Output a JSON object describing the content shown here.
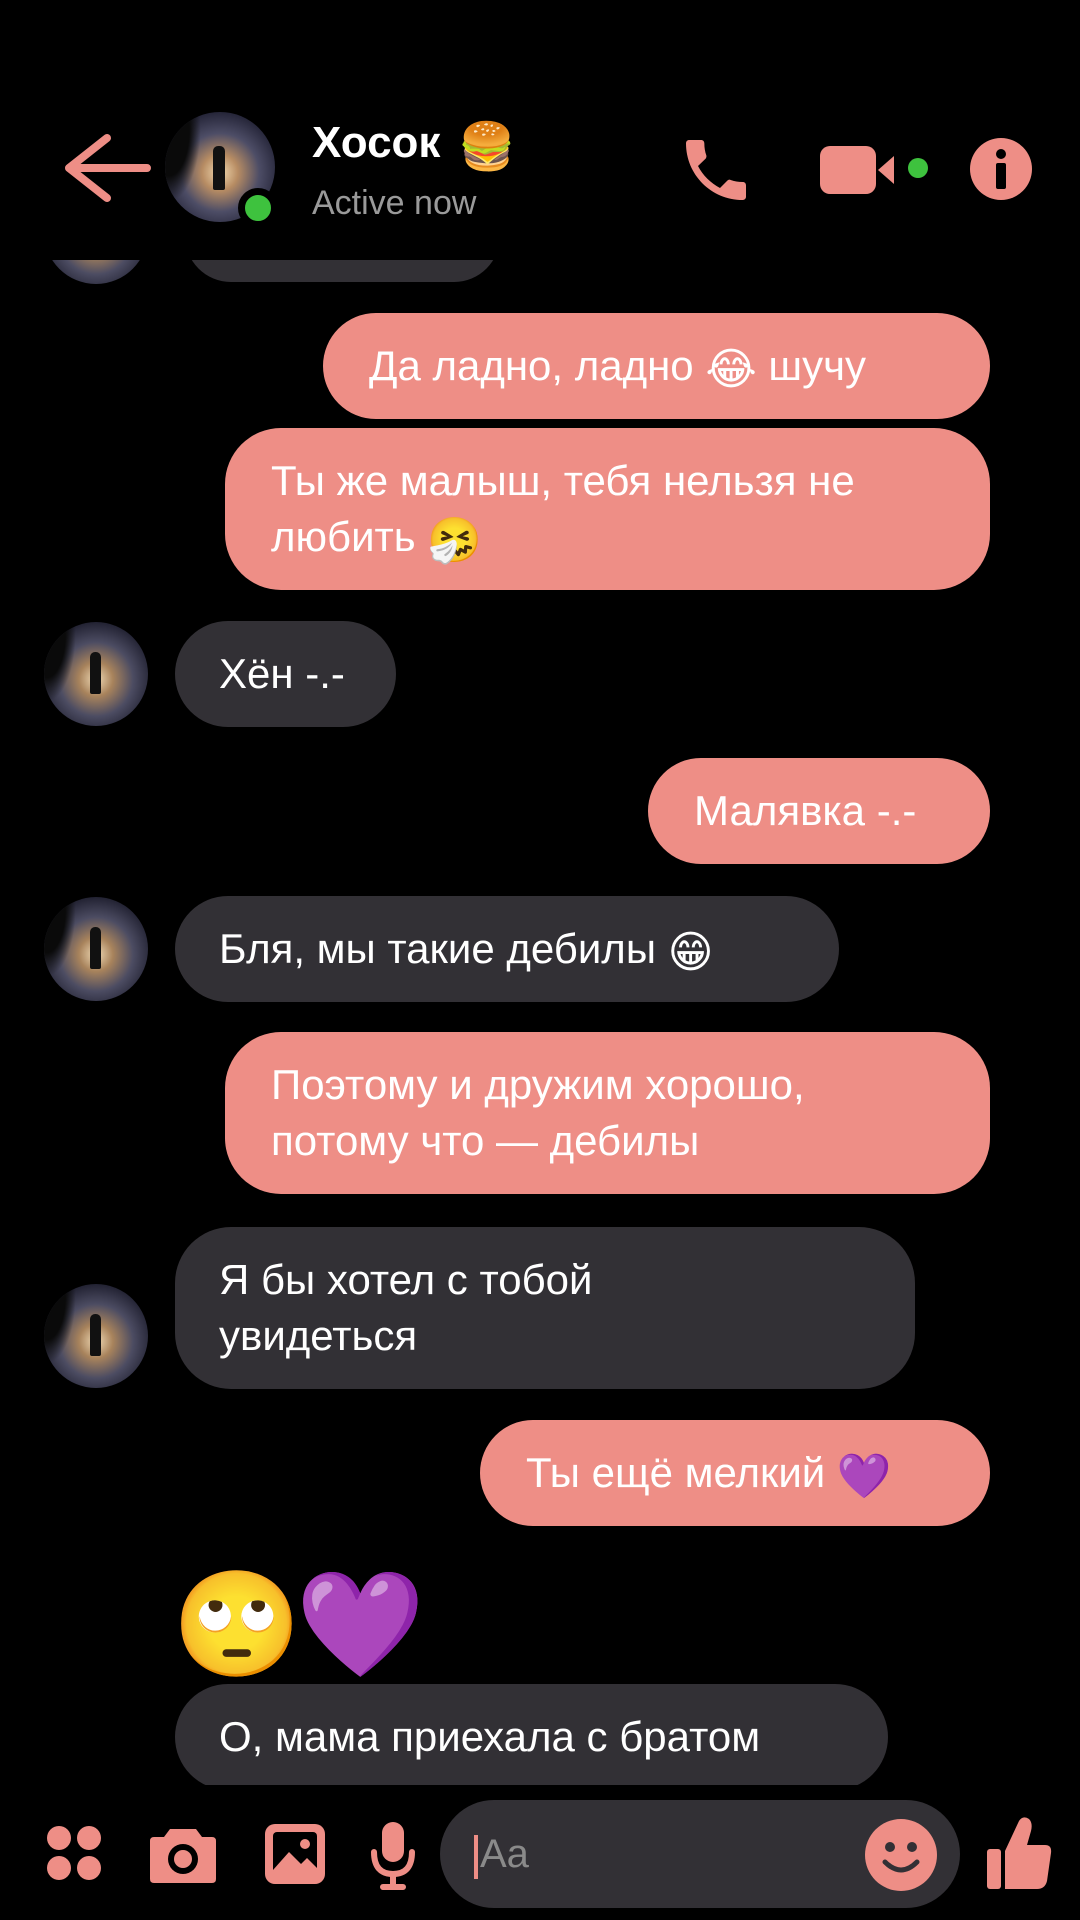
{
  "header": {
    "back_icon": "arrow-left-icon",
    "contact_name": "Хосок",
    "name_emoji": "🍔",
    "status": "Active now",
    "call_icon": "phone-icon",
    "video_icon": "video-camera-icon",
    "info_icon": "info-icon"
  },
  "messages": [
    {
      "dir": "sent",
      "text": "Да ладно, ладно ",
      "emoji": "😂",
      "tail": " шучу"
    },
    {
      "dir": "sent",
      "line1": "Ты же малыш, тебя нельзя не",
      "line2": "любить ",
      "emoji": "🤧"
    },
    {
      "dir": "received",
      "text": "Хён -.-"
    },
    {
      "dir": "sent",
      "text": "Малявка -.-"
    },
    {
      "dir": "received",
      "text": "Бля, мы такие дебилы ",
      "emoji": "😁"
    },
    {
      "dir": "sent",
      "line1": "Поэтому и дружим хорошо,",
      "line2": "потому что — дебилы"
    },
    {
      "dir": "received",
      "line1": "Я бы хотел с тобой",
      "line2": "увидеться"
    },
    {
      "dir": "sent",
      "text": "Ты ещё мелкий ",
      "emoji": "💜"
    },
    {
      "dir": "received",
      "emojis": "🙄💜"
    },
    {
      "dir": "received",
      "text": "О, мама приехала с братом"
    }
  ],
  "composer": {
    "apps_icon": "apps-dots-icon",
    "camera_icon": "camera-icon",
    "gallery_icon": "image-gallery-icon",
    "mic_icon": "microphone-icon",
    "placeholder": "Aa",
    "emoji_icon": "smiley-icon",
    "like_icon": "thumbs-up-icon"
  },
  "colors": {
    "accent": "#ee8e86",
    "background": "#000000",
    "received_bubble": "#323035",
    "online": "#3ec23e"
  }
}
